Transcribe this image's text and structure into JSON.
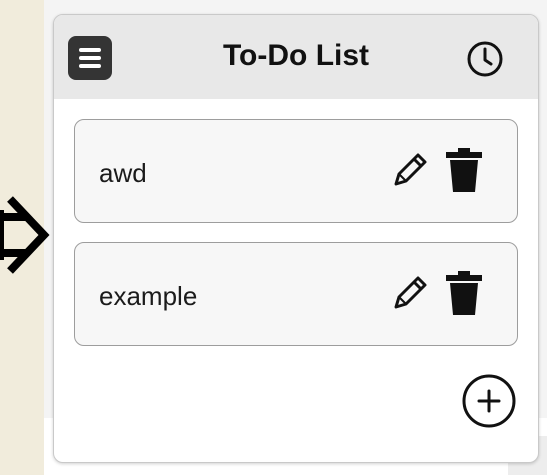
{
  "app": {
    "title": "To-Do List"
  },
  "header": {
    "menu_icon": "hamburger-menu-icon",
    "history_icon": "clock-icon"
  },
  "todos": [
    {
      "text": "awd",
      "edit_icon": "pencil-icon",
      "delete_icon": "trash-icon"
    },
    {
      "text": "example",
      "edit_icon": "pencil-icon",
      "delete_icon": "trash-icon"
    }
  ],
  "footer": {
    "add_icon": "plus-circle-icon"
  },
  "colors": {
    "header_bg": "#e8e8e8",
    "menu_button_bg": "#343434",
    "item_border": "#9d9d9d",
    "item_bg": "#f7f7f7",
    "left_strip": "#f1ecdc"
  }
}
